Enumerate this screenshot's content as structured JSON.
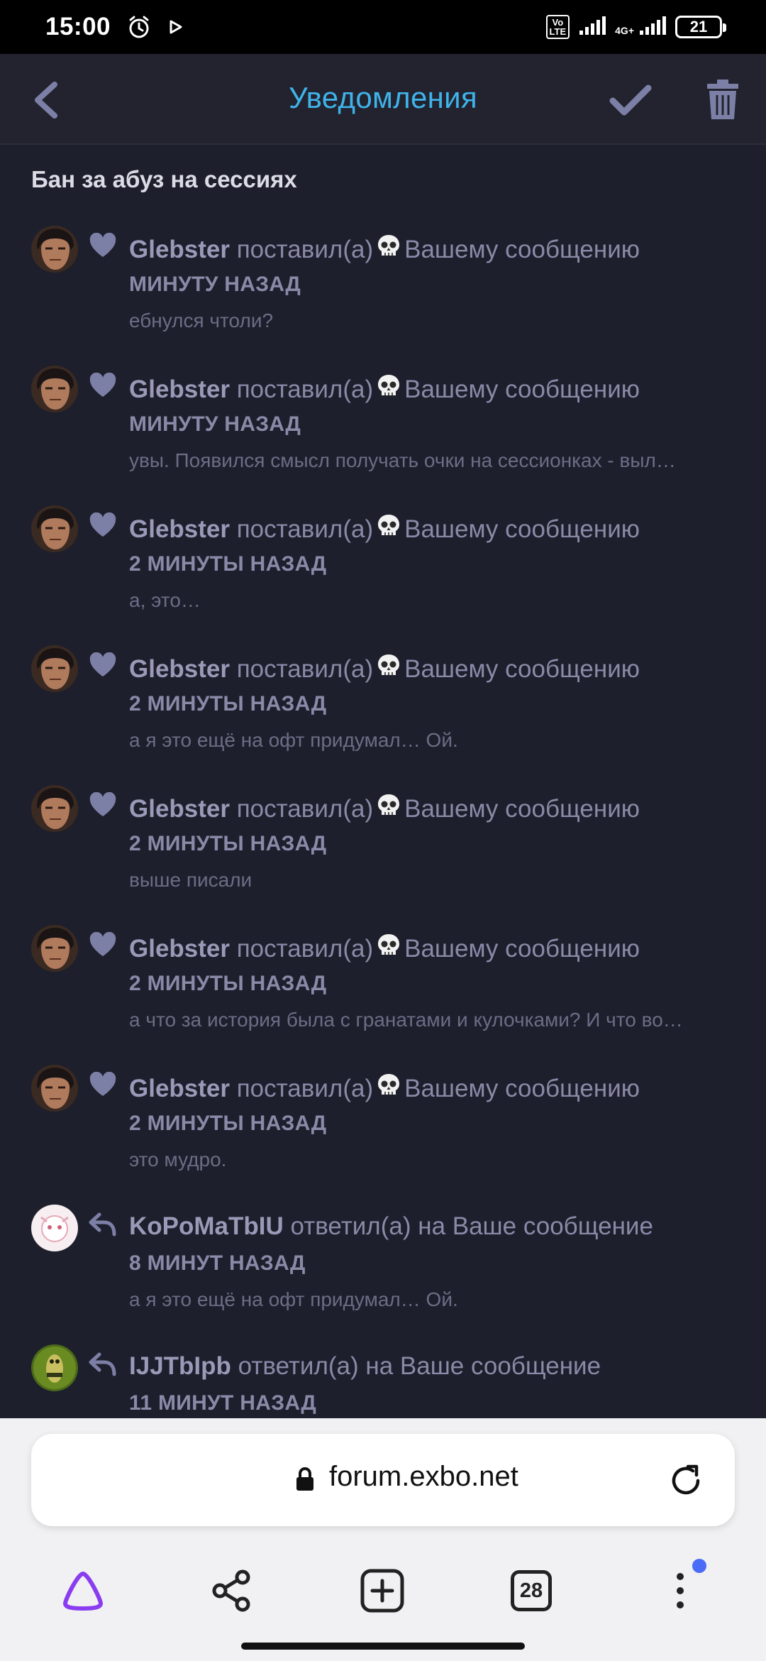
{
  "status": {
    "time": "15:00",
    "volte": "Vo\nLTE",
    "network": "4G+",
    "battery": "21"
  },
  "header": {
    "title": "Уведомления"
  },
  "section_title": "Бан за абуз на сессиях",
  "notifications": [
    {
      "type": "like",
      "user": "Glebster",
      "action_pre": "поставил(а)",
      "action_post": "Вашему сообщению",
      "time": "минуту назад",
      "excerpt": "ебнулся чтоли?"
    },
    {
      "type": "like",
      "user": "Glebster",
      "action_pre": "поставил(а)",
      "action_post": "Вашему сообщению",
      "time": "минуту назад",
      "excerpt": "увы. Появился смысл получать очки на сессионках - выл…"
    },
    {
      "type": "like",
      "user": "Glebster",
      "action_pre": "поставил(а)",
      "action_post": "Вашему сообщению",
      "time": "2 минуты назад",
      "excerpt": "а, это…"
    },
    {
      "type": "like",
      "user": "Glebster",
      "action_pre": "поставил(а)",
      "action_post": "Вашему сообщению",
      "time": "2 минуты назад",
      "excerpt": "а я это ещё на офт придумал… Ой."
    },
    {
      "type": "like",
      "user": "Glebster",
      "action_pre": "поставил(а)",
      "action_post": "Вашему сообщению",
      "time": "2 минуты назад",
      "excerpt": "выше писали"
    },
    {
      "type": "like",
      "user": "Glebster",
      "action_pre": "поставил(а)",
      "action_post": "Вашему сообщению",
      "time": "2 минуты назад",
      "excerpt": "а что за история была с гранатами и кулочками? И что во…"
    },
    {
      "type": "like",
      "user": "Glebster",
      "action_pre": "поставил(а)",
      "action_post": "Вашему сообщению",
      "time": "2 минуты назад",
      "excerpt": "это мудро."
    },
    {
      "type": "reply",
      "user": "KoPoMaTbIU",
      "action": "ответил(а) на Ваше сообщение",
      "time": "8 минут назад",
      "excerpt": "а я это ещё на офт придумал… Ой."
    },
    {
      "type": "reply",
      "user": "IJJTbIpb",
      "action": "ответил(а) на Ваше сообщение",
      "time": "11 минут назад",
      "excerpt": ""
    }
  ],
  "browser": {
    "url": "forum.exbo.net",
    "tabs_count": "28"
  },
  "colors": {
    "accent": "#3fb3ea",
    "background": "#1e1f2c",
    "icon_muted": "#7d80a6",
    "notification_dot": "#4a6cf7",
    "assistant_purple": "#8a3df0"
  }
}
